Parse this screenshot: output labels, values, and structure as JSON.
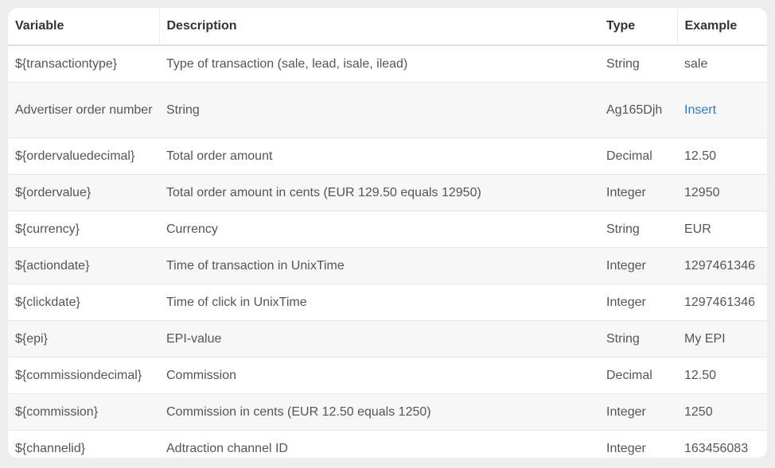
{
  "table": {
    "headers": [
      "Variable",
      "Description",
      "Type",
      "Example"
    ],
    "rows": [
      [
        "${transactiontype}",
        "Type of transaction (sale, lead, isale, ilead)",
        "String",
        "sale"
      ],
      [
        "Advertiser order number",
        "String",
        "Ag165Djh",
        "Insert"
      ],
      [
        "${ordervaluedecimal}",
        "Total order amount",
        "Decimal",
        "12.50"
      ],
      [
        "${ordervalue}",
        "Total order amount in cents (EUR 129.50 equals 12950)",
        "Integer",
        "12950"
      ],
      [
        "${currency}",
        "Currency",
        "String",
        "EUR"
      ],
      [
        "${actiondate}",
        "Time of transaction in UnixTime",
        "Integer",
        "1297461346"
      ],
      [
        "${clickdate}",
        "Time of click in UnixTime",
        "Integer",
        "1297461346"
      ],
      [
        "${epi}",
        "EPI-value",
        "String",
        "My EPI"
      ],
      [
        "${commissiondecimal}",
        "Commission",
        "Decimal",
        "12.50"
      ],
      [
        "${commission}",
        "Commission in cents (EUR 12.50 equals 1250)",
        "Integer",
        "1250"
      ],
      [
        "${channelid}",
        "Adtraction channel ID",
        "Integer",
        "163456083"
      ]
    ]
  },
  "colors": {
    "link": "#2b7bc0",
    "stripe": "#f7f7f7"
  }
}
